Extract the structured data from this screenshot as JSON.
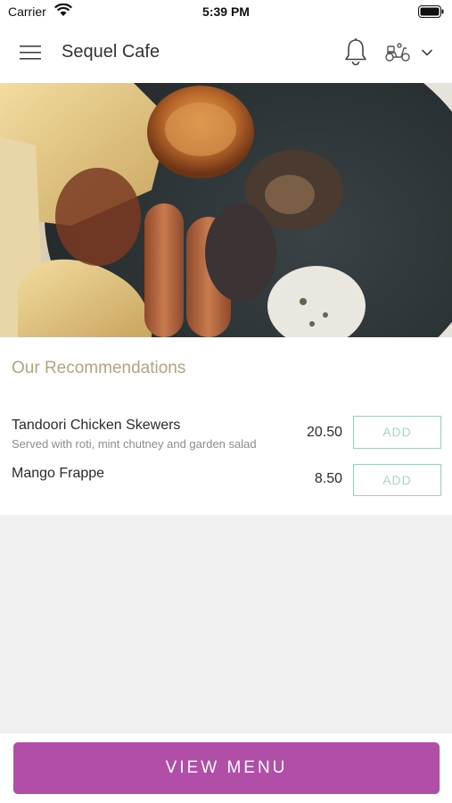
{
  "status_bar": {
    "carrier": "Carrier",
    "time": "5:39 PM",
    "icons": [
      "wifi-icon",
      "battery-icon"
    ]
  },
  "header": {
    "title": "Sequel Cafe",
    "icons": [
      "hamburger-icon",
      "bell-icon",
      "scooter-icon",
      "chevron-down-icon"
    ]
  },
  "hero": {
    "image": "breakfast-plate-photo"
  },
  "recommendations": {
    "title": "Our Recommendations",
    "items": [
      {
        "name": "Tandoori Chicken Skewers",
        "description": "Served with roti, mint chutney and garden salad",
        "price": "20.50",
        "add_label": "ADD"
      },
      {
        "name": "Mango Frappe",
        "description": "",
        "price": "8.50",
        "add_label": "ADD"
      }
    ]
  },
  "footer": {
    "view_menu_label": "VIEW MENU"
  },
  "colors": {
    "accent": "#b04ea8",
    "section_title": "#b8a27f",
    "add_border": "#9fd2b8",
    "background": "#f0f0f0"
  }
}
